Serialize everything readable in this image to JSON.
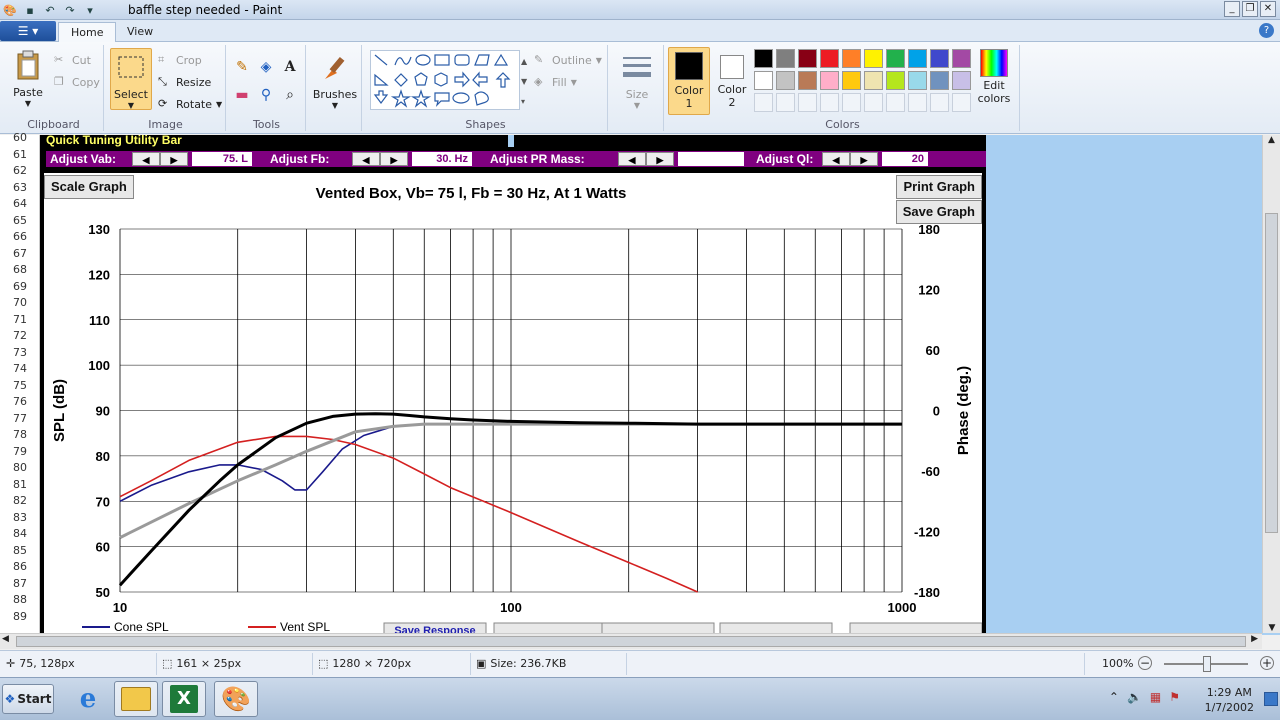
{
  "window": {
    "title": "baffle step needed - Paint"
  },
  "tabs": [
    {
      "label": "Home"
    },
    {
      "label": "View"
    }
  ],
  "ribbon": {
    "clipboard": {
      "label": "Clipboard",
      "paste": "Paste",
      "cut": "Cut",
      "copy": "Copy"
    },
    "image": {
      "label": "Image",
      "select": "Select",
      "crop": "Crop",
      "resize": "Resize",
      "rotate": "Rotate"
    },
    "tools": {
      "label": "Tools"
    },
    "brushes": {
      "label": "Brushes"
    },
    "shapes": {
      "label": "Shapes",
      "outline": "Outline",
      "fill": "Fill"
    },
    "size": {
      "label": "Size"
    },
    "colors": {
      "label": "Colors",
      "color1": "Color\n1",
      "color1_a": "Color",
      "color1_b": "1",
      "color2_a": "Color",
      "color2_b": "2",
      "edit_a": "Edit",
      "edit_b": "colors",
      "palette_row1": [
        "#000000",
        "#7f7f7f",
        "#880015",
        "#ed1c24",
        "#ff7f27",
        "#fff200",
        "#22b14c",
        "#00a2e8",
        "#3f48cc",
        "#a349a4"
      ],
      "palette_row2": [
        "#ffffff",
        "#c3c3c3",
        "#b97a57",
        "#ffaec9",
        "#ffc90e",
        "#efe4b0",
        "#b5e61d",
        "#99d9ea",
        "#7092be",
        "#c8bfe7"
      ]
    }
  },
  "rows": [
    "60",
    "61",
    "62",
    "63",
    "64",
    "65",
    "66",
    "67",
    "68",
    "69",
    "70",
    "71",
    "72",
    "73",
    "74",
    "75",
    "76",
    "77",
    "78",
    "79",
    "80",
    "81",
    "82",
    "83",
    "84",
    "85",
    "86",
    "87",
    "88",
    "89"
  ],
  "utility": {
    "title": "Quick Tuning Utility Bar",
    "adjust_vab": "Adjust Vab:",
    "vab_value": "75. L",
    "adjust_fb": "Adjust Fb:",
    "fb_value": "30. Hz",
    "adjust_pr": "Adjust PR Mass:",
    "pr_value": "",
    "adjust_ql": "Adjust Ql:",
    "ql_value": "20"
  },
  "graph": {
    "scale_btn": "Scale Graph",
    "print_btn": "Print Graph",
    "save_btn": "Save Graph",
    "save_response": "Save Response"
  },
  "chart_data": {
    "type": "line",
    "title": "Vented Box, Vb= 75 l,  Fb = 30 Hz,  At 1 Watts",
    "xlabel": "",
    "ylabel": "SPL (dB)",
    "y2label": "Phase (deg.)",
    "xscale": "log",
    "xlim": [
      10,
      1000
    ],
    "ylim": [
      50,
      130
    ],
    "y2lim": [
      -180,
      180
    ],
    "xticks": [
      "10",
      "100",
      "1000"
    ],
    "yticks": [
      "50",
      "60",
      "70",
      "80",
      "90",
      "100",
      "110",
      "120",
      "130"
    ],
    "y2ticks": [
      "-180",
      "-120",
      "-60",
      "0",
      "60",
      "120",
      "180"
    ],
    "grid": true,
    "legend": "bottom",
    "series": [
      {
        "name": "Cone SPL",
        "color": "#1a1a8c",
        "x": [
          10,
          12,
          15,
          18,
          20,
          23,
          26,
          28,
          30,
          33,
          37,
          42,
          50,
          60,
          70,
          100
        ],
        "y": [
          70,
          73.5,
          76.5,
          78,
          78,
          77,
          74.5,
          72.5,
          72.5,
          76.5,
          81.5,
          84.5,
          86.5,
          87,
          87,
          87
        ]
      },
      {
        "name": "Vent SPL",
        "color": "#d42020",
        "x": [
          10,
          12,
          15,
          20,
          25,
          30,
          35,
          40,
          50,
          60,
          70,
          100,
          150,
          200,
          250,
          300
        ],
        "y": [
          71,
          74.5,
          79,
          83,
          84.3,
          84.3,
          83.6,
          82.5,
          79.5,
          76,
          73,
          67.5,
          61,
          56.5,
          53,
          50
        ]
      },
      {
        "name": "",
        "color": "#9a9a9a",
        "x": [
          10,
          15,
          20,
          25,
          30,
          40,
          50,
          60,
          80,
          100,
          1000
        ],
        "y": [
          62,
          69.5,
          74.5,
          78,
          81,
          85.3,
          86.5,
          87,
          87,
          87,
          87
        ]
      },
      {
        "name": "",
        "color": "#000000",
        "x": [
          10,
          12,
          15,
          18,
          20,
          25,
          30,
          35,
          40,
          45,
          50,
          55,
          60,
          70,
          80,
          100,
          150,
          200,
          300,
          1000
        ],
        "y": [
          51.5,
          59,
          68,
          74.5,
          78,
          84,
          87.2,
          88.7,
          89.2,
          89.3,
          89.2,
          88.9,
          88.6,
          88.2,
          87.9,
          87.6,
          87.3,
          87.2,
          87,
          87
        ]
      }
    ]
  },
  "statusbar": {
    "cursor": "75, 128px",
    "selection": "161 × 25px",
    "canvas": "1280 × 720px",
    "size": "Size: 236.7KB",
    "zoom": "100%"
  },
  "taskbar": {
    "start": "Start",
    "time": "1:29 AM",
    "date": "1/7/2002"
  }
}
